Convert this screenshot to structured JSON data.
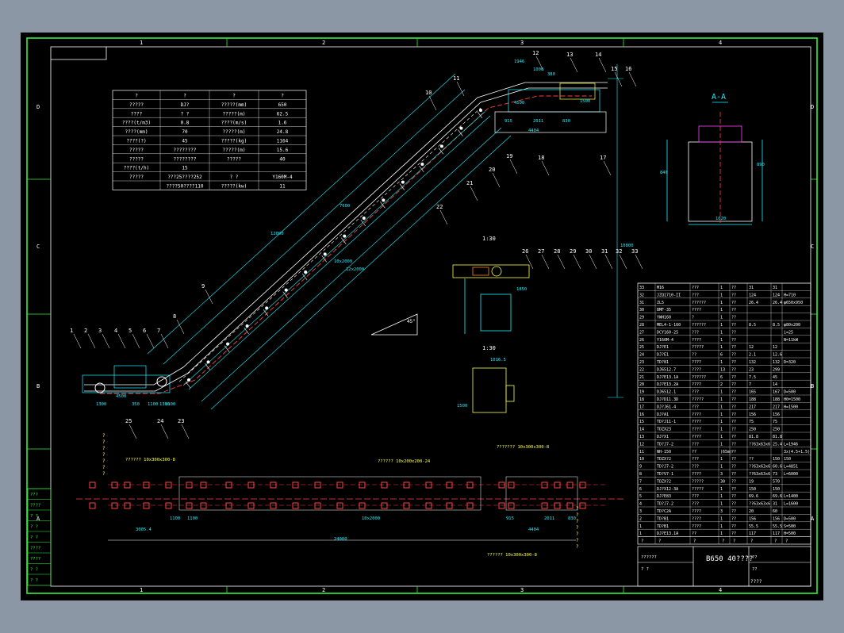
{
  "drawing_title": "B650 40????",
  "zone_cols": [
    "1",
    "2",
    "3",
    "4"
  ],
  "zone_rows": [
    "D",
    "C",
    "B",
    "A"
  ],
  "section_label": "A-A",
  "params": {
    "header": [
      "?",
      "?",
      "?",
      "?"
    ],
    "rows": [
      [
        "?????",
        "DJ?",
        "?????(mm)",
        "650"
      ],
      [
        "????",
        "? ?",
        "?????(m)",
        "62.5"
      ],
      [
        "????(t/m3)",
        "0.8",
        "????(m/s)",
        "1.6"
      ],
      [
        "????(mm)",
        "70",
        "?????(m)",
        "24.8"
      ],
      [
        "????(?)",
        "45",
        "?????(kg)",
        "1164"
      ],
      [
        "?????",
        "????????",
        "?????(m)",
        "15.6"
      ],
      [
        "?????",
        "????????",
        "?????",
        "40"
      ],
      [
        "????(t/h)",
        "15",
        "",
        ""
      ],
      [
        "?????",
        "???25????252",
        "?  ?",
        "Y160M-4"
      ],
      [
        "",
        "????50????110",
        "?????(kw)",
        "11"
      ]
    ]
  },
  "callouts": [
    "1",
    "2",
    "3",
    "4",
    "5",
    "6",
    "7",
    "8",
    "9",
    "10",
    "11",
    "12",
    "13",
    "14",
    "15",
    "16",
    "17",
    "18",
    "19",
    "20",
    "21",
    "22",
    "23",
    "24",
    "25",
    "26",
    "27",
    "28",
    "29",
    "30",
    "31",
    "32",
    "33"
  ],
  "scale_labels": [
    "1:30",
    "1:30"
  ],
  "dims": {
    "top": [
      "1946",
      "1000",
      "380",
      "4500",
      "1500",
      "915",
      "2011",
      "830",
      "4404"
    ],
    "section": [
      "840",
      "890",
      "1020"
    ],
    "left": [
      "1300",
      "4500",
      "350",
      "1100",
      "1300",
      "1100"
    ],
    "slope": [
      "12000",
      "10x2000",
      "12x2000",
      "7000"
    ],
    "vertical": [
      "10800"
    ],
    "bottom": [
      "24000",
      "10x2000",
      "3005.4",
      "1100",
      "1100",
      "4404",
      "2011",
      "915",
      "830"
    ],
    "detail": [
      "1016.5",
      "1500",
      "1850"
    ],
    "angle": "45°"
  },
  "foundation_labels": [
    "?????? 10x300x300-8",
    "?????? 10x200x200-24",
    "?????? 10x300x300-8",
    "??????? 10x300x300-8"
  ],
  "vertical_notes": [
    "???????",
    "???????"
  ],
  "parts": [
    [
      "33",
      "M16",
      "???",
      "1",
      "??",
      "31",
      "31",
      ""
    ],
    [
      "32",
      "JZQ1710-II",
      "???",
      "1",
      "??",
      "124",
      "124",
      "H=710"
    ],
    [
      "31",
      "ZL5",
      "??????",
      "1",
      "??",
      "26.4",
      "26.4",
      "φ650x950"
    ],
    [
      "30",
      "BMF-35",
      "????",
      "1",
      "??",
      "",
      "",
      ""
    ],
    [
      "29",
      "YWH160",
      "?",
      "1",
      "??",
      "",
      "",
      ""
    ],
    [
      "28",
      "MEL4-1-160",
      "??????",
      "1",
      "??",
      "8.5",
      "8.5",
      "φ80x200"
    ],
    [
      "27",
      "DCY160-25",
      "???",
      "1",
      "??",
      "",
      "",
      "i=25"
    ],
    [
      "26",
      "Y160M-4",
      "????",
      "1",
      "??",
      "",
      "",
      "N=11kW"
    ],
    [
      "25",
      "DJ?E1",
      "?????",
      "1",
      "??",
      "12",
      "12",
      ""
    ],
    [
      "24",
      "DJ?E1",
      "??",
      "6",
      "??",
      "2.1",
      "12.6",
      ""
    ],
    [
      "23",
      "TD?81",
      "????",
      "1",
      "??",
      "132",
      "132",
      "D=320"
    ],
    [
      "22",
      "DJ6512.7",
      "????",
      "13",
      "??",
      "23",
      "299",
      ""
    ],
    [
      "21",
      "DJ?E13.1A",
      "??????",
      "6",
      "??",
      "7.5",
      "45",
      ""
    ],
    [
      "20",
      "DJ?E13.2A",
      "????",
      "2",
      "??",
      "7",
      "14",
      ""
    ],
    [
      "19",
      "DJ6512.1",
      "???",
      "1",
      "??",
      "165",
      "167",
      "D=500"
    ],
    [
      "18",
      "DJ?D11.3D",
      "?????",
      "1",
      "??",
      "188",
      "188",
      "H0=1500"
    ],
    [
      "17",
      "DJ?J61-4",
      "???",
      "1",
      "??",
      "217",
      "217",
      "H=1500"
    ],
    [
      "16",
      "DJ?A1",
      "????",
      "1",
      "??",
      "156",
      "156",
      ""
    ],
    [
      "15",
      "TD?J11-1",
      "????",
      "1",
      "??",
      "75",
      "75",
      ""
    ],
    [
      "14",
      "TDZX23",
      "????",
      "1",
      "??",
      "250",
      "250",
      ""
    ],
    [
      "13",
      "DJ?X1",
      "????",
      "1",
      "??",
      "81.8",
      "81.8",
      ""
    ],
    [
      "12",
      "TD?J7-2",
      "???",
      "1",
      "??",
      "??63x63x6",
      "25.4",
      "L=1946"
    ],
    [
      "11",
      "NH-150",
      "??",
      "(65m)",
      "??",
      "",
      "",
      "3x(4.5+1.5)"
    ],
    [
      "10",
      "TDZX?2",
      "???",
      "1",
      "??",
      "??",
      "150",
      "150"
    ],
    [
      "9",
      "TD?J7-2",
      "???",
      "1",
      "??",
      "??63x63x6",
      "60.6",
      "L=4851"
    ],
    [
      "8",
      "TD?V7-1",
      "????",
      "3",
      "??",
      "??63x63x6",
      "73",
      "L=6000"
    ],
    [
      "7",
      "TDZX?2",
      "?????",
      "30",
      "??",
      "19",
      "570",
      ""
    ],
    [
      "6",
      "DJ?X12-3A",
      "?????",
      "1",
      "??",
      "150",
      "150",
      ""
    ],
    [
      "5",
      "DJ?E83",
      "???",
      "1",
      "??",
      "69.6",
      "69.6",
      "L=1400"
    ],
    [
      "4",
      "TD?J7-2",
      "???",
      "1",
      "??",
      "??63x63x6",
      "31",
      "L=1600"
    ],
    [
      "3",
      "TD?C2A",
      "????",
      "3",
      "??",
      "20",
      "60",
      ""
    ],
    [
      "2",
      "TD?B1",
      "????",
      "1",
      "??",
      "156",
      "156",
      "D=500"
    ],
    [
      "1",
      "TD?B1",
      "????",
      "1",
      "??",
      "55.5",
      "55.5",
      "S=500"
    ],
    [
      "1",
      "DJ?E13.1A",
      "??",
      "1",
      "??",
      "117",
      "117",
      "H=500"
    ]
  ],
  "parts_footer": [
    "?",
    "?",
    "?",
    "?",
    "?",
    "?",
    "?",
    "?"
  ],
  "left_tabs": [
    "???",
    "????",
    "? ?",
    "? ?",
    "? ?",
    "????",
    "????",
    "? ?",
    "? ?"
  ],
  "title_block": [
    "??????",
    "?  ?",
    "??",
    "??"
  ],
  "sheet_note": "????"
}
